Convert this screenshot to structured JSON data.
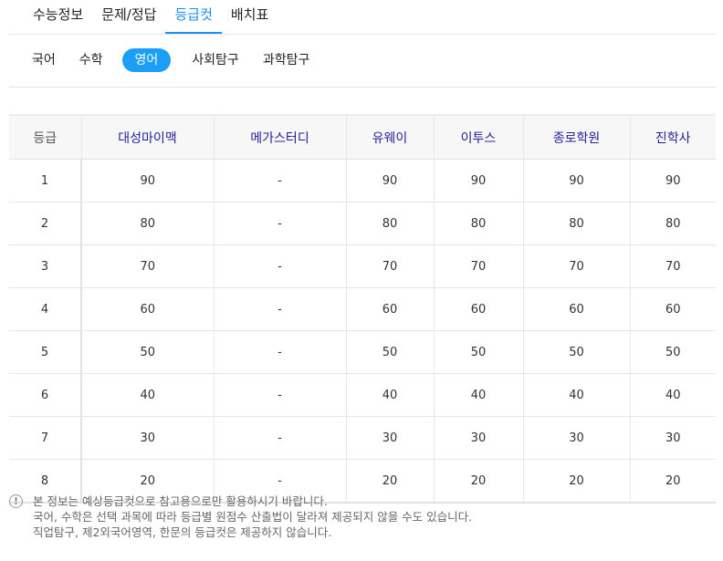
{
  "top_tabs": [
    "수능정보",
    "문제/정답",
    "등급컷",
    "배치표"
  ],
  "subjects": [
    "국어",
    "수학",
    "영어",
    "사회탐구",
    "과학탐구"
  ],
  "table": {
    "headers": [
      "등급",
      "대성마이맥",
      "메가스터디",
      "유웨이",
      "이투스",
      "종로학원",
      "진학사"
    ],
    "rows": [
      [
        "1",
        "90",
        "-",
        "90",
        "90",
        "90",
        "90"
      ],
      [
        "2",
        "80",
        "-",
        "80",
        "80",
        "80",
        "80"
      ],
      [
        "3",
        "70",
        "-",
        "70",
        "70",
        "70",
        "70"
      ],
      [
        "4",
        "60",
        "-",
        "60",
        "60",
        "60",
        "60"
      ],
      [
        "5",
        "50",
        "-",
        "50",
        "50",
        "50",
        "50"
      ],
      [
        "6",
        "40",
        "-",
        "40",
        "40",
        "40",
        "40"
      ],
      [
        "7",
        "30",
        "-",
        "30",
        "30",
        "30",
        "30"
      ],
      [
        "8",
        "20",
        "-",
        "20",
        "20",
        "20",
        "20"
      ]
    ]
  },
  "notes": {
    "icon": "exclamation-icon",
    "lines": [
      "본 정보는 예상등급컷으로 참고용으로만 활용하시기 바랍니다.",
      "국어, 수학은 선택 과목에 따라 등급별 원점수 산출법이 달라져 제공되지 않을 수도 있습니다.",
      "직업탐구, 제2외국어영역, 한문의 등급컷은 제공하지 않습니다."
    ]
  },
  "colors": {
    "accent": "#1a8ef5",
    "pill_active": "#1a9ef8",
    "header_text": "#25209a"
  }
}
